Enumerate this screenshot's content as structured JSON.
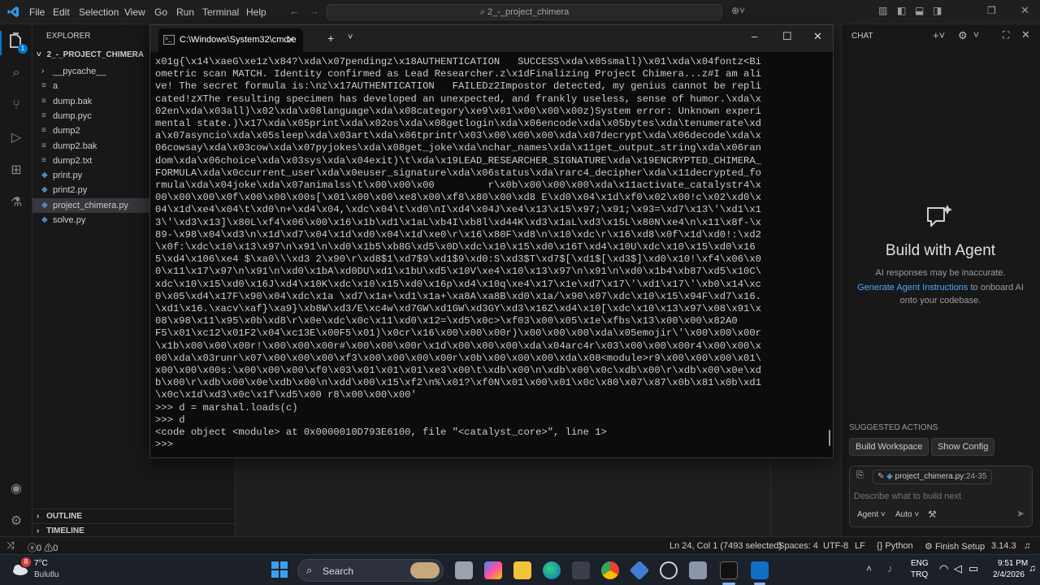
{
  "menubar": {
    "items": [
      "File",
      "Edit",
      "Selection",
      "View",
      "Go",
      "Run",
      "Terminal",
      "Help"
    ],
    "search": "2_-_project_chimera"
  },
  "explorer": {
    "title": "EXPLORER",
    "folder": "2_-_PROJECT_CHIMERA",
    "files": [
      {
        "name": "__pycache__",
        "kind": "folder"
      },
      {
        "name": "a",
        "kind": "file"
      },
      {
        "name": "dump.bak",
        "kind": "file"
      },
      {
        "name": "dump.pyc",
        "kind": "file"
      },
      {
        "name": "dump2",
        "kind": "file"
      },
      {
        "name": "dump2.bak",
        "kind": "file"
      },
      {
        "name": "dump2.txt",
        "kind": "file"
      },
      {
        "name": "print.py",
        "kind": "py"
      },
      {
        "name": "print2.py",
        "kind": "py"
      },
      {
        "name": "project_chimera.py",
        "kind": "py"
      },
      {
        "name": "solve.py",
        "kind": "py"
      }
    ],
    "outline": "OUTLINE",
    "timeline": "TIMELINE"
  },
  "terminal": {
    "tab_title": "C:\\Windows\\System32\\cmd.e",
    "lines": [
      "x01g{\\x14\\xaeG\\xe1z\\x84?\\xda\\x07pendingz\\x18AUTHENTICATION   SUCCESS\\xda\\x05small)\\x01\\xda\\x04fontz<Bi",
      "ometric scan MATCH. Identity confirmed as Lead Researcher.z\\x1dFinalizing Project Chimera...z#I am ali",
      "ve! The secret formula is:\\nz\\x17AUTHENTICATION   FAILEDz2Impostor detected, my genius cannot be repli",
      "cated!zXThe resulting specimen has developed an unexpected, and frankly useless, sense of humor.\\xda\\x",
      "02en\\xda\\x03all)\\x02\\xda\\x08language\\xda\\x08category\\xe9\\x01\\x00\\x00\\x00z)System error: Unknown experi",
      "mental state.)\\x17\\xda\\x05print\\xda\\x02os\\xda\\x08getlogin\\xda\\x06encode\\xda\\x05bytes\\xda\\tenumerate\\xd",
      "a\\x07asyncio\\xda\\x05sleep\\xda\\x03art\\xda\\x06tprintr\\x03\\x00\\x00\\x00\\xda\\x07decrypt\\xda\\x06decode\\xda\\x",
      "06cowsay\\xda\\x03cow\\xda\\x07pyjokes\\xda\\x08get_joke\\xda\\nchar_names\\xda\\x11get_output_string\\xda\\x06ran",
      "dom\\xda\\x06choice\\xda\\x03sys\\xda\\x04exit)\\t\\xda\\x19LEAD_RESEARCHER_SIGNATURE\\xda\\x19ENCRYPTED_CHIMERA_",
      "FORMULA\\xda\\x0ccurrent_user\\xda\\x0euser_signature\\xda\\x06status\\xda\\rarc4_decipher\\xda\\x11decrypted_fo",
      "rmula\\xda\\x04joke\\xda\\x07animalss\\t\\x00\\x00\\x00         r\\x0b\\x00\\x00\\x00\\xda\\x11activate_catalystr4\\x",
      "00\\x00\\x00\\x0f\\x00\\x00\\x00s[\\x01\\x00\\x00\\xe8\\x00\\xf8\\x80\\x00\\xd8 E\\xd0\\x04\\x1d\\xf0\\x02\\x00!c\\x02\\xd0\\x",
      "04\\x1d\\xe4\\x04\\t\\xd0\\n+\\xd4\\x04,\\xdc\\x04\\t\\xd0\\nI\\xd4\\x04J\\xe4\\x13\\x15\\x97;\\x91;\\x93=\\xd7\\x13\\'\\xd1\\x1",
      "3\\'\\xd3\\x13]\\x80L\\xf4\\x06\\x00\\x16\\x1b\\xd1\\x1aL\\xb4I\\xb8l\\xd44K\\xd3\\x1aL\\xd3\\x15L\\x80N\\xe4\\n\\x11\\x8f-\\x",
      "89-\\x98\\x04\\xd3\\n\\x1d\\xd7\\x04\\x1d\\xd0\\x04\\x1d\\xe0\\r\\x16\\x80F\\xd8\\n\\x10\\xdc\\r\\x16\\xd8\\x0f\\x1d\\xd0!:\\xd2",
      "\\x0f:\\xdc\\x10\\x13\\x97\\n\\x91\\n\\xd0\\x1b5\\xb8G\\xd5\\x0D\\xdc\\x10\\x15\\xd0\\x16T\\xd4\\x10U\\xdc\\x10\\x15\\xd0\\x16",
      "5\\xd4\\x106\\xe4 $\\xa0\\\\\\xd3 2\\x90\\r\\xd8$1\\xd7$9\\xd1$9\\xd0:S\\xd3$T\\xd7$[\\xd1$[\\xd3$]\\xd0\\x10!\\xf4\\x06\\x0",
      "0\\x11\\x17\\x97\\n\\x91\\n\\xd0\\x1bA\\xd0DU\\xd1\\x1bU\\xd5\\x10V\\xe4\\x10\\x13\\x97\\n\\x91\\n\\xd0\\x1b4\\xb87\\xd5\\x10C\\",
      "xdc\\x10\\x15\\xd0\\x16J\\xd4\\x10K\\xdc\\x10\\x15\\xd0\\x16p\\xd4\\x10q\\xe4\\x17\\x1e\\xd7\\x17\\'\\xd1\\x17\\'\\xb0\\x14\\xc",
      "0\\x05\\xd4\\x17F\\x90\\x04\\xdc\\x1a \\xd7\\x1a+\\xd1\\x1a+\\xa8A\\xa8B\\xd0\\x1a/\\x90\\x07\\xdc\\x10\\x15\\x94F\\xd7\\x16.",
      "\\xd1\\x16.\\xacv\\xaf}\\xa9}\\xb8W\\xd3/E\\xc4w\\xd7GW\\xd1GW\\xd3GY\\xd3\\x16Z\\xd4\\x10[\\xdc\\x10\\x13\\x97\\x08\\x91\\x",
      "08\\x98\\x11\\x95\\x0b\\xd8\\r\\x0e\\xdc\\x0c\\x11\\xd0\\x12=\\xd5\\x0c>\\xf03\\x00\\x05\\x1e\\xfbs\\x13\\x00\\x00\\x82A0",
      "F5\\x01\\xc12\\x01F2\\x04\\xc13E\\x00F5\\x01)\\x0cr\\x16\\x00\\x00\\x00r)\\x00\\x00\\x00\\xda\\x05emojir\\'\\x00\\x00\\x00r",
      "\\x1b\\x00\\x00\\x00r!\\x00\\x00\\x00r#\\x00\\x00\\x00r\\x1d\\x00\\x00\\x00\\xda\\x04arc4r\\x03\\x00\\x00\\x00r4\\x00\\x00\\x",
      "00\\xda\\x03runr\\x07\\x00\\x00\\x00\\xf3\\x00\\x00\\x00\\x00r\\x0b\\x00\\x00\\x00\\xda\\x08<module>r9\\x00\\x00\\x00\\x01\\",
      "x00\\x00\\x00s:\\x00\\x00\\x00\\xf0\\x03\\x01\\x01\\x01\\xe3\\x00\\t\\xdb\\x00\\n\\xdb\\x00\\x0c\\xdb\\x00\\r\\xdb\\x00\\x0e\\xd",
      "b\\x00\\r\\xdb\\x00\\x0e\\xdb\\x00\\n\\xdd\\x00\\x15\\xf2\\n%\\x01?\\xf0N\\x01\\x00\\x01\\x0c\\x80\\x07\\x87\\x0b\\x81\\x0b\\xd1",
      "\\x0c\\x1d\\xd3\\x0c\\x1f\\xd5\\x00 r8\\x00\\x00\\x00'",
      ">>> d = marshal.loads(c)",
      ">>> d",
      "<code object <module> at 0x0000010D793E6100, file \"<catalyst_core>\", line 1>",
      ">>>"
    ]
  },
  "chat": {
    "header": "CHAT",
    "title": "Build with Agent",
    "disclaimer": "AI responses may be inaccurate.",
    "link": "Generate Agent Instructions",
    "link_rest": " to onboard AI",
    "line2": "onto your codebase.",
    "suggested_label": "SUGGESTED ACTIONS",
    "actions": [
      "Build Workspace",
      "Show Config"
    ],
    "context_file": "project_chimera.py",
    "context_range": ":24-35",
    "placeholder": "Describe what to build next",
    "mode": "Agent",
    "model": "Auto"
  },
  "status": {
    "errors": "0",
    "warnings": "0",
    "position": "Ln 24, Col 1 (7493 selected)",
    "spaces": "Spaces: 4",
    "encoding": "UTF-8",
    "eol": "LF",
    "language": "Python",
    "finish": "Finish Setup",
    "version": "3.14.3"
  },
  "taskbar": {
    "temp": "7°C",
    "weather": "Bulutlu",
    "weather_badge": "8",
    "search": "Search",
    "lang1": "ENG",
    "lang2": "TRQ",
    "time": "9:51 PM",
    "date": "2/4/2026"
  },
  "colors": {
    "accent": "#0078d4",
    "link": "#4daafc",
    "status_bg": "#181818"
  }
}
